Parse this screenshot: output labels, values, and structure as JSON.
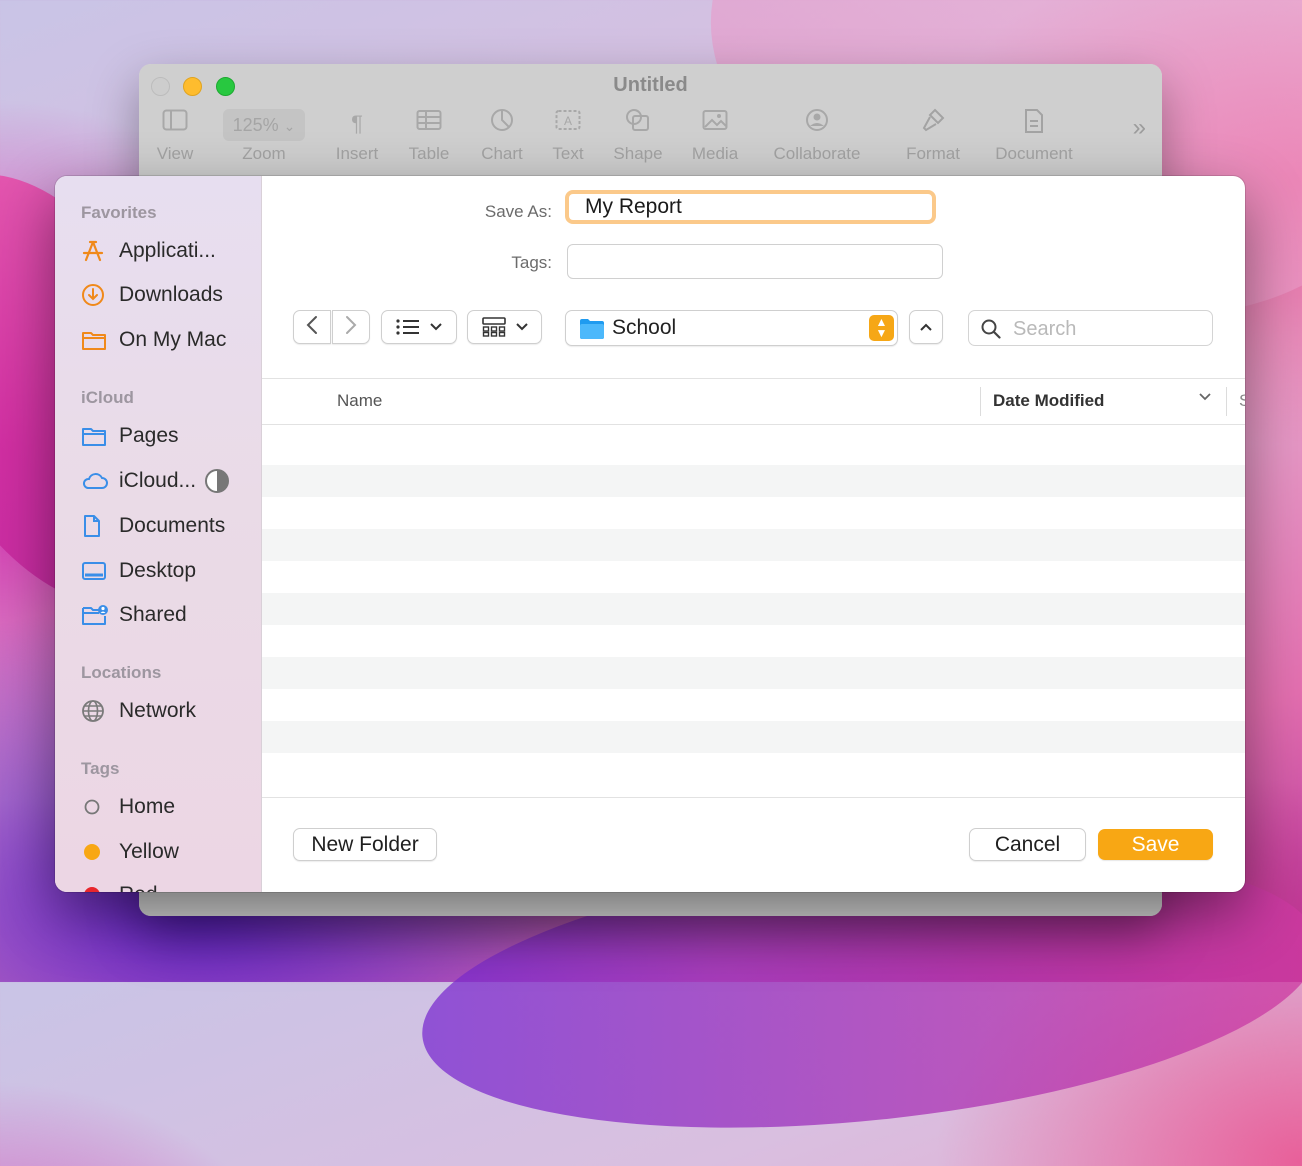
{
  "window": {
    "title": "Untitled",
    "toolbar": [
      {
        "label": "View",
        "icon": "sidebar-icon"
      },
      {
        "label": "Zoom",
        "value": "125%",
        "icon": "zoom-popup"
      },
      {
        "label": "Insert",
        "icon": "pilcrow-icon"
      },
      {
        "label": "Table",
        "icon": "table-icon"
      },
      {
        "label": "Chart",
        "icon": "chart-icon"
      },
      {
        "label": "Text",
        "icon": "text-box-icon"
      },
      {
        "label": "Shape",
        "icon": "shape-icon"
      },
      {
        "label": "Media",
        "icon": "media-icon"
      },
      {
        "label": "Collaborate",
        "icon": "collaborate-icon"
      },
      {
        "label": "Format",
        "icon": "paintbrush-icon"
      },
      {
        "label": "Document",
        "icon": "document-icon"
      }
    ]
  },
  "sidebar": {
    "favorites": {
      "heading": "Favorites",
      "items": [
        {
          "label": "Applicati...",
          "icon": "applications-icon"
        },
        {
          "label": "Downloads",
          "icon": "downloads-icon"
        },
        {
          "label": "On My Mac",
          "icon": "folder-icon"
        }
      ]
    },
    "icloud": {
      "heading": "iCloud",
      "items": [
        {
          "label": "Pages",
          "icon": "folder-icon"
        },
        {
          "label": "iCloud...",
          "icon": "cloud-icon"
        },
        {
          "label": "Documents",
          "icon": "document-icon"
        },
        {
          "label": "Desktop",
          "icon": "desktop-icon"
        },
        {
          "label": "Shared",
          "icon": "shared-folder-icon"
        }
      ]
    },
    "locations": {
      "heading": "Locations",
      "items": [
        {
          "label": "Network",
          "icon": "globe-icon"
        }
      ]
    },
    "tags": {
      "heading": "Tags",
      "items": [
        {
          "label": "Home",
          "color": "#ffffff"
        },
        {
          "label": "Yellow",
          "color": "#f8a714"
        },
        {
          "label": "Red",
          "color": "#e8262d"
        }
      ]
    }
  },
  "form": {
    "save_as_label": "Save As:",
    "save_as_value": "My Report",
    "tags_label": "Tags:",
    "tags_value": ""
  },
  "navbar": {
    "location": "School",
    "search_placeholder": "Search"
  },
  "file_list": {
    "columns": [
      "Name",
      "Date Modified",
      "S"
    ],
    "sort_column": "Date Modified",
    "rows": []
  },
  "footer": {
    "new_folder_label": "New Folder",
    "cancel_label": "Cancel",
    "save_label": "Save"
  },
  "colors": {
    "accent": "#f8a714",
    "focus_ring": "#fbc98a",
    "folder_blue": "#1f9bf0",
    "sidebar_icon_orange": "#f0891a",
    "sidebar_icon_blue": "#3a8ee8"
  }
}
